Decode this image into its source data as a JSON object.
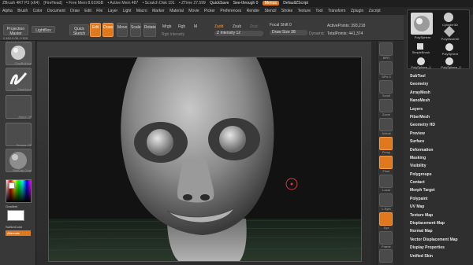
{
  "titlebar": {
    "app": "ZBrush 4R7 P3 (x64)",
    "doc": "[FireHead]",
    "items": [
      "• Free Mem 8.619GB",
      "• Active Mem 487",
      "• Scratch Disk 191",
      "• ZTime 27.599",
      "Timer 0.005",
      "• PolyCount 383,218 KP",
      "• MeshCount 1"
    ],
    "quicksave": "QuickSave",
    "seethrough": "See-through 0",
    "menus": "Menus",
    "defaultscript": "DefaultZScript"
  },
  "menubar": {
    "items": [
      "Alpha",
      "Brush",
      "Color",
      "Document",
      "Draw",
      "Edit",
      "File",
      "Layer",
      "Light",
      "Macro",
      "Marker",
      "Material",
      "Movie",
      "Picker",
      "Preferences",
      "Render",
      "Stencil",
      "Stroke",
      "Texture",
      "Tool",
      "Transform",
      "Zplugin",
      "Zscript"
    ]
  },
  "shelf": {
    "projection_master": "Projection Master",
    "lightbox": "LightBox",
    "quick_sketch": "Quick Sketch",
    "edit": "Edit",
    "draw": "Draw",
    "move": "Move",
    "scale": "Scale",
    "rotate": "Rotate",
    "mrgb": "Mrgb",
    "rgb": "Rgb",
    "m": "M",
    "zadd": "Zadd",
    "zsub": "Zsub",
    "zcut": "Zcut",
    "rgb_intensity": "Rgb Intensity",
    "z_intensity": "Z Intensity 12",
    "focal_shift": "Focal Shift 0",
    "draw_size": "Draw Size 38",
    "dynamic": "Dynamic",
    "active_points": "ActivePoints: 393,218",
    "total_points": "TotalPoints: 441,374",
    "coords": "0.462,0.05,-0.528"
  },
  "lefttray": {
    "brush_label": "ClayBuildup",
    "stroke_label": "FreeHand",
    "alpha_label": "Alpha Off",
    "texture_label": "Texture Off",
    "material_label": "MatCap Gray",
    "gradient_label": "Gradient",
    "switchcolor_label": "SwitchColor",
    "alternate_label": "Alternate"
  },
  "righticons": [
    "BPR",
    "SPix 3",
    "Scroll",
    "Zoom",
    "Actual",
    "AAHalf",
    "Dynamic",
    "Persp",
    "Floor",
    "Local",
    "L.Sym",
    "Xyz",
    "Frame",
    "Move",
    "Scale",
    "Rotate",
    "Line Fill",
    "PolyF",
    "Transp",
    "Ghost",
    "Solo",
    "Xpose"
  ],
  "toolpanel": {
    "current_tool": "PolySphere",
    "tools": [
      "Cylinder3D",
      "PolyMesh3D",
      "SimpleBrush",
      "PolySphere",
      "PolySphere_1",
      "PolySphere_2"
    ]
  },
  "submenu": [
    "SubTool",
    "Geometry",
    "ArrayMesh",
    "NanoMesh",
    "Layers",
    "FiberMesh",
    "Geometry HD",
    "Preview",
    "Surface",
    "Deformation",
    "Masking",
    "Visibility",
    "Polygroups",
    "Contact",
    "Morph Target",
    "Polypaint",
    "UV Map",
    "Texture Map",
    "Displacement Map",
    "Normal Map",
    "Vector Displacement Map",
    "Display Properties",
    "Unified Skin"
  ],
  "colors": {
    "accent": "#e0781e",
    "bg": "#2a2a2a",
    "viewport": "#121212"
  }
}
